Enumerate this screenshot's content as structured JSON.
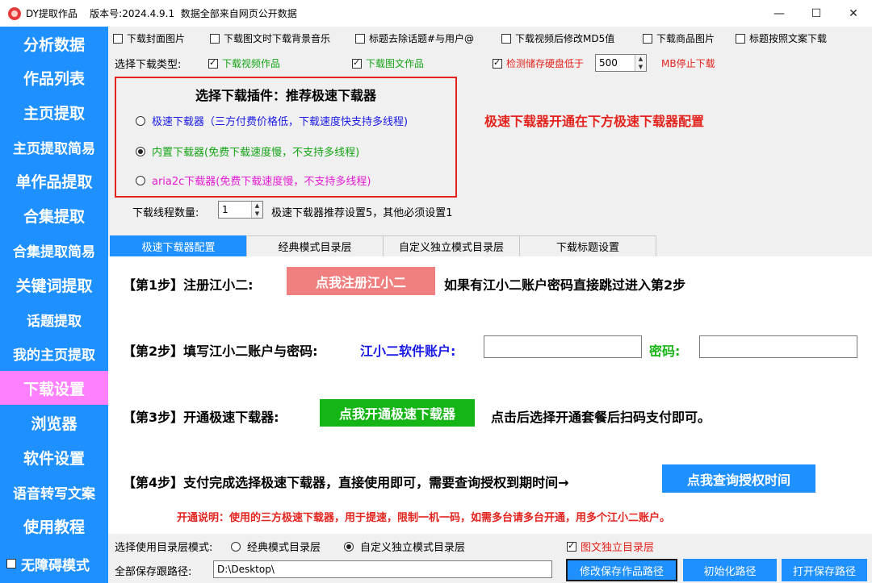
{
  "window": {
    "title": "DY提取作品    版本号:2024.4.9.1  数据全部来自网页公开数据",
    "controls": {
      "minimize": "—",
      "maximize": "☐",
      "close": "✕"
    }
  },
  "sidebar": {
    "items": [
      {
        "label": "分析数据"
      },
      {
        "label": "作品列表"
      },
      {
        "label": "主页提取"
      },
      {
        "label": "主页提取简易"
      },
      {
        "label": "单作品提取"
      },
      {
        "label": "合集提取"
      },
      {
        "label": "合集提取简易"
      },
      {
        "label": "关键词提取"
      },
      {
        "label": "话题提取"
      },
      {
        "label": "我的主页提取"
      },
      {
        "label": "下载设置"
      },
      {
        "label": "浏览器"
      },
      {
        "label": "软件设置"
      },
      {
        "label": "语音转写文案"
      },
      {
        "label": "使用教程"
      }
    ],
    "active_index": 10,
    "accessibility_label": "无障碍模式",
    "accent": "#1e90ff",
    "active_color": "#ff80ff"
  },
  "options": {
    "row1": [
      {
        "label": "下载封面图片",
        "checked": false
      },
      {
        "label": "下载图文时下载背景音乐",
        "checked": false
      },
      {
        "label": "标题去除话题#与用户@",
        "checked": false
      },
      {
        "label": "下载视频后修改MD5值",
        "checked": false
      },
      {
        "label": "下载商品图片",
        "checked": false
      },
      {
        "label": "标题按照文案下载",
        "checked": false
      }
    ],
    "type_label": "选择下载类型:",
    "video_label": "下载视频作品",
    "image_label": "下载图文作品",
    "disk_label": "检测储存硬盘低于",
    "disk_value": "500",
    "disk_suffix": "MB停止下载"
  },
  "plugin": {
    "title": "选择下载插件：推荐极速下载器",
    "options": [
      {
        "label": "极速下载器（三方付费价格低，下载速度快支持多线程)",
        "selected": false
      },
      {
        "label": "内置下载器(免费下载速度慢，不支持多线程)",
        "selected": true
      },
      {
        "label": "aria2c下载器(免费下载速度慢，不支持多线程)",
        "selected": false
      }
    ],
    "hint": "极速下载器开通在下方极速下载器配置"
  },
  "threads": {
    "label": "下载线程数量:",
    "value": "1",
    "hint": "极速下载器推荐设置5，其他必须设置1"
  },
  "tabs": [
    {
      "label": "极速下载器配置",
      "active": true
    },
    {
      "label": "经典模式目录层",
      "active": false
    },
    {
      "label": "自定义独立模式目录层",
      "active": false
    },
    {
      "label": "下载标题设置",
      "active": false
    }
  ],
  "steps": {
    "step1": {
      "text": "【第1步】注册江小二:",
      "button": "点我注册江小二",
      "hint": "如果有江小二账户密码直接跳过进入第2步"
    },
    "step2": {
      "text": "【第2步】填写江小二账户与密码:",
      "account_label": "江小二软件账户:",
      "account_value": "",
      "password_label": "密码:",
      "password_value": ""
    },
    "step3": {
      "text": "【第3步】开通极速下载器:",
      "button": "点我开通极速下载器",
      "hint": "点击后选择开通套餐后扫码支付即可。"
    },
    "step4": {
      "text": "【第4步】支付完成选择极速下载器，直接使用即可，需要查询授权到期时间→",
      "button": "点我查询授权时间"
    },
    "note": "开通说明：使用的三方极速下载器，用于提速，限制一机一码，如需多台请多台开通，用多个江小二账户。"
  },
  "bottom": {
    "mode_label": "选择使用目录层模式:",
    "mode_classic": "经典模式目录层",
    "mode_custom": "自定义独立模式目录层",
    "mode_selected": "custom",
    "separate_label": "图文独立目录层",
    "separate_checked": true,
    "path_label": "全部保存跟路径:",
    "path_value": "D:\\Desktop\\",
    "btn_modify": "修改保存作品路径",
    "btn_init": "初始化路径",
    "btn_open": "打开保存路径"
  },
  "colors": {
    "register_button": "#f08080",
    "open_button": "#16b516",
    "query_button": "#1e90ff",
    "red_text": "#e3231e",
    "green_text": "#16a316",
    "blue_text": "#1a1ae6",
    "magenta_text": "#e31cd4"
  }
}
